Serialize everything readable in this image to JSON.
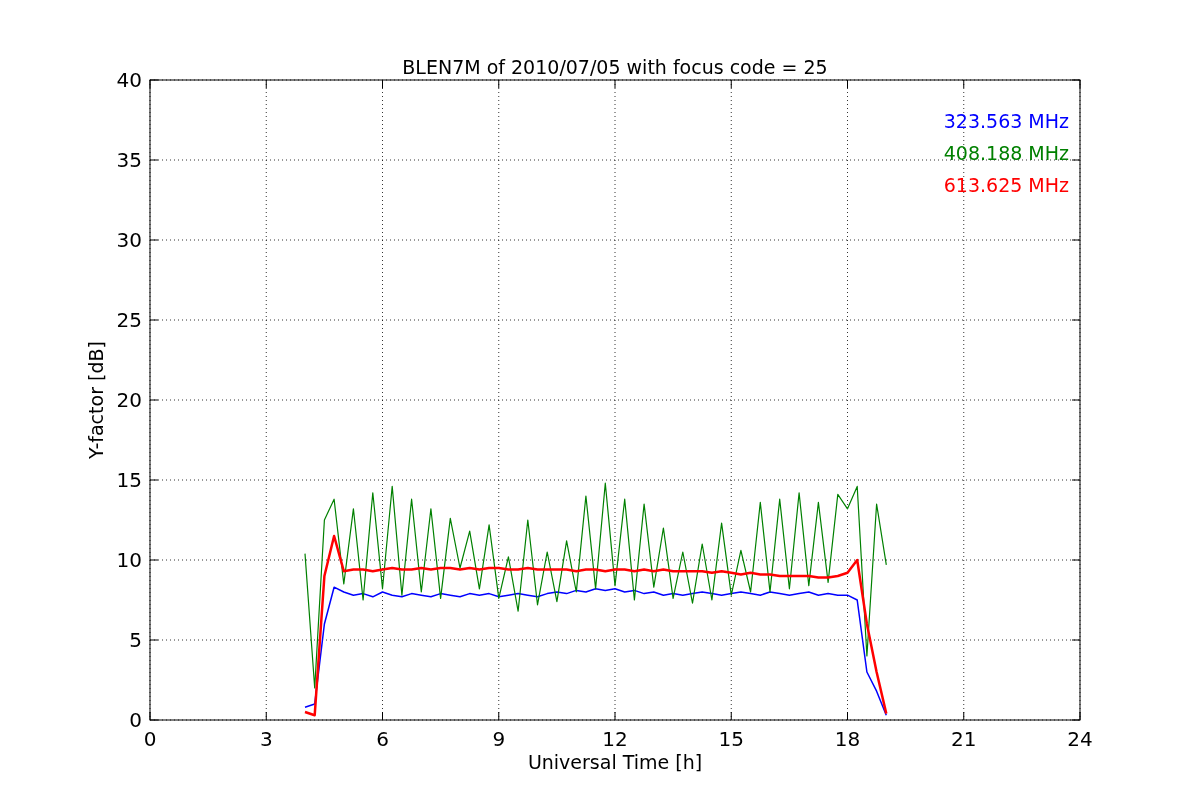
{
  "figure": {
    "chart_data": {
      "type": "line",
      "title": "BLEN7M of 2010/07/05 with focus code = 25",
      "xlabel": "Universal Time [h]",
      "ylabel": "Y-factor [dB]",
      "x": [
        4,
        4.25,
        4.5,
        4.75,
        5,
        5.25,
        5.5,
        5.75,
        6,
        6.25,
        6.5,
        6.75,
        7,
        7.25,
        7.5,
        7.75,
        8,
        8.25,
        8.5,
        8.75,
        9,
        9.25,
        9.5,
        9.75,
        10,
        10.25,
        10.5,
        10.75,
        11,
        11.25,
        11.5,
        11.75,
        12,
        12.25,
        12.5,
        12.75,
        13,
        13.25,
        13.5,
        13.75,
        14,
        14.25,
        14.5,
        14.75,
        15,
        15.25,
        15.5,
        15.75,
        16,
        16.25,
        16.5,
        16.75,
        17,
        17.25,
        17.5,
        17.75,
        18,
        18.25,
        18.5,
        18.75,
        19
      ],
      "series": [
        {
          "name": "323.563 MHz",
          "color": "#0000ff",
          "values": [
            0.8,
            1.0,
            6,
            8.3,
            8,
            7.8,
            7.9,
            7.7,
            8,
            7.8,
            7.7,
            7.9,
            7.8,
            7.7,
            7.9,
            7.8,
            7.7,
            7.9,
            7.8,
            7.9,
            7.7,
            7.8,
            7.9,
            7.8,
            7.7,
            7.9,
            8,
            7.9,
            8.1,
            8,
            8.2,
            8.1,
            8.2,
            8,
            8.1,
            7.9,
            8,
            7.8,
            7.9,
            7.8,
            7.9,
            8,
            7.9,
            7.8,
            7.9,
            8,
            7.9,
            7.8,
            8,
            7.9,
            7.8,
            7.9,
            8,
            7.8,
            7.9,
            7.8,
            7.8,
            7.5,
            3,
            1.8,
            0.3
          ]
        },
        {
          "name": "408.188 MHz",
          "color": "#008000",
          "values": [
            10.4,
            2,
            12.5,
            13.8,
            8.5,
            13.2,
            7.5,
            14.2,
            8.2,
            14.6,
            7.8,
            13.8,
            8,
            13.2,
            7.6,
            12.6,
            9.5,
            11.8,
            8.2,
            12.2,
            7.6,
            10.2,
            6.8,
            12.5,
            7.2,
            10.5,
            7.4,
            11.2,
            8,
            14,
            8.2,
            14.8,
            8.4,
            13.8,
            7.5,
            13.5,
            8.3,
            12,
            7.6,
            10.5,
            7.3,
            11,
            7.5,
            12.3,
            7.8,
            10.6,
            8,
            13.6,
            8,
            13.8,
            8.2,
            14.2,
            8.4,
            13.6,
            8.6,
            14.1,
            13.2,
            14.6,
            4,
            13.5,
            9.7
          ]
        },
        {
          "name": "613.625 MHz",
          "color": "#ff0000",
          "values": [
            0.5,
            0.3,
            9,
            11.5,
            9.3,
            9.4,
            9.4,
            9.3,
            9.4,
            9.5,
            9.4,
            9.4,
            9.5,
            9.4,
            9.5,
            9.5,
            9.4,
            9.5,
            9.4,
            9.5,
            9.5,
            9.4,
            9.4,
            9.5,
            9.4,
            9.4,
            9.4,
            9.4,
            9.3,
            9.4,
            9.4,
            9.3,
            9.4,
            9.4,
            9.3,
            9.4,
            9.3,
            9.4,
            9.3,
            9.3,
            9.3,
            9.3,
            9.2,
            9.3,
            9.2,
            9.1,
            9.2,
            9.1,
            9.1,
            9.0,
            9.0,
            9.0,
            9.0,
            8.9,
            8.9,
            9.0,
            9.2,
            10,
            6,
            3,
            0.4
          ]
        }
      ],
      "grid": true,
      "xlim": [
        0,
        24
      ],
      "ylim": [
        0,
        40
      ],
      "xticks": [
        0,
        3,
        6,
        9,
        12,
        15,
        18,
        21,
        24
      ],
      "yticks": [
        0,
        5,
        10,
        15,
        20,
        25,
        30,
        35,
        40
      ]
    }
  }
}
